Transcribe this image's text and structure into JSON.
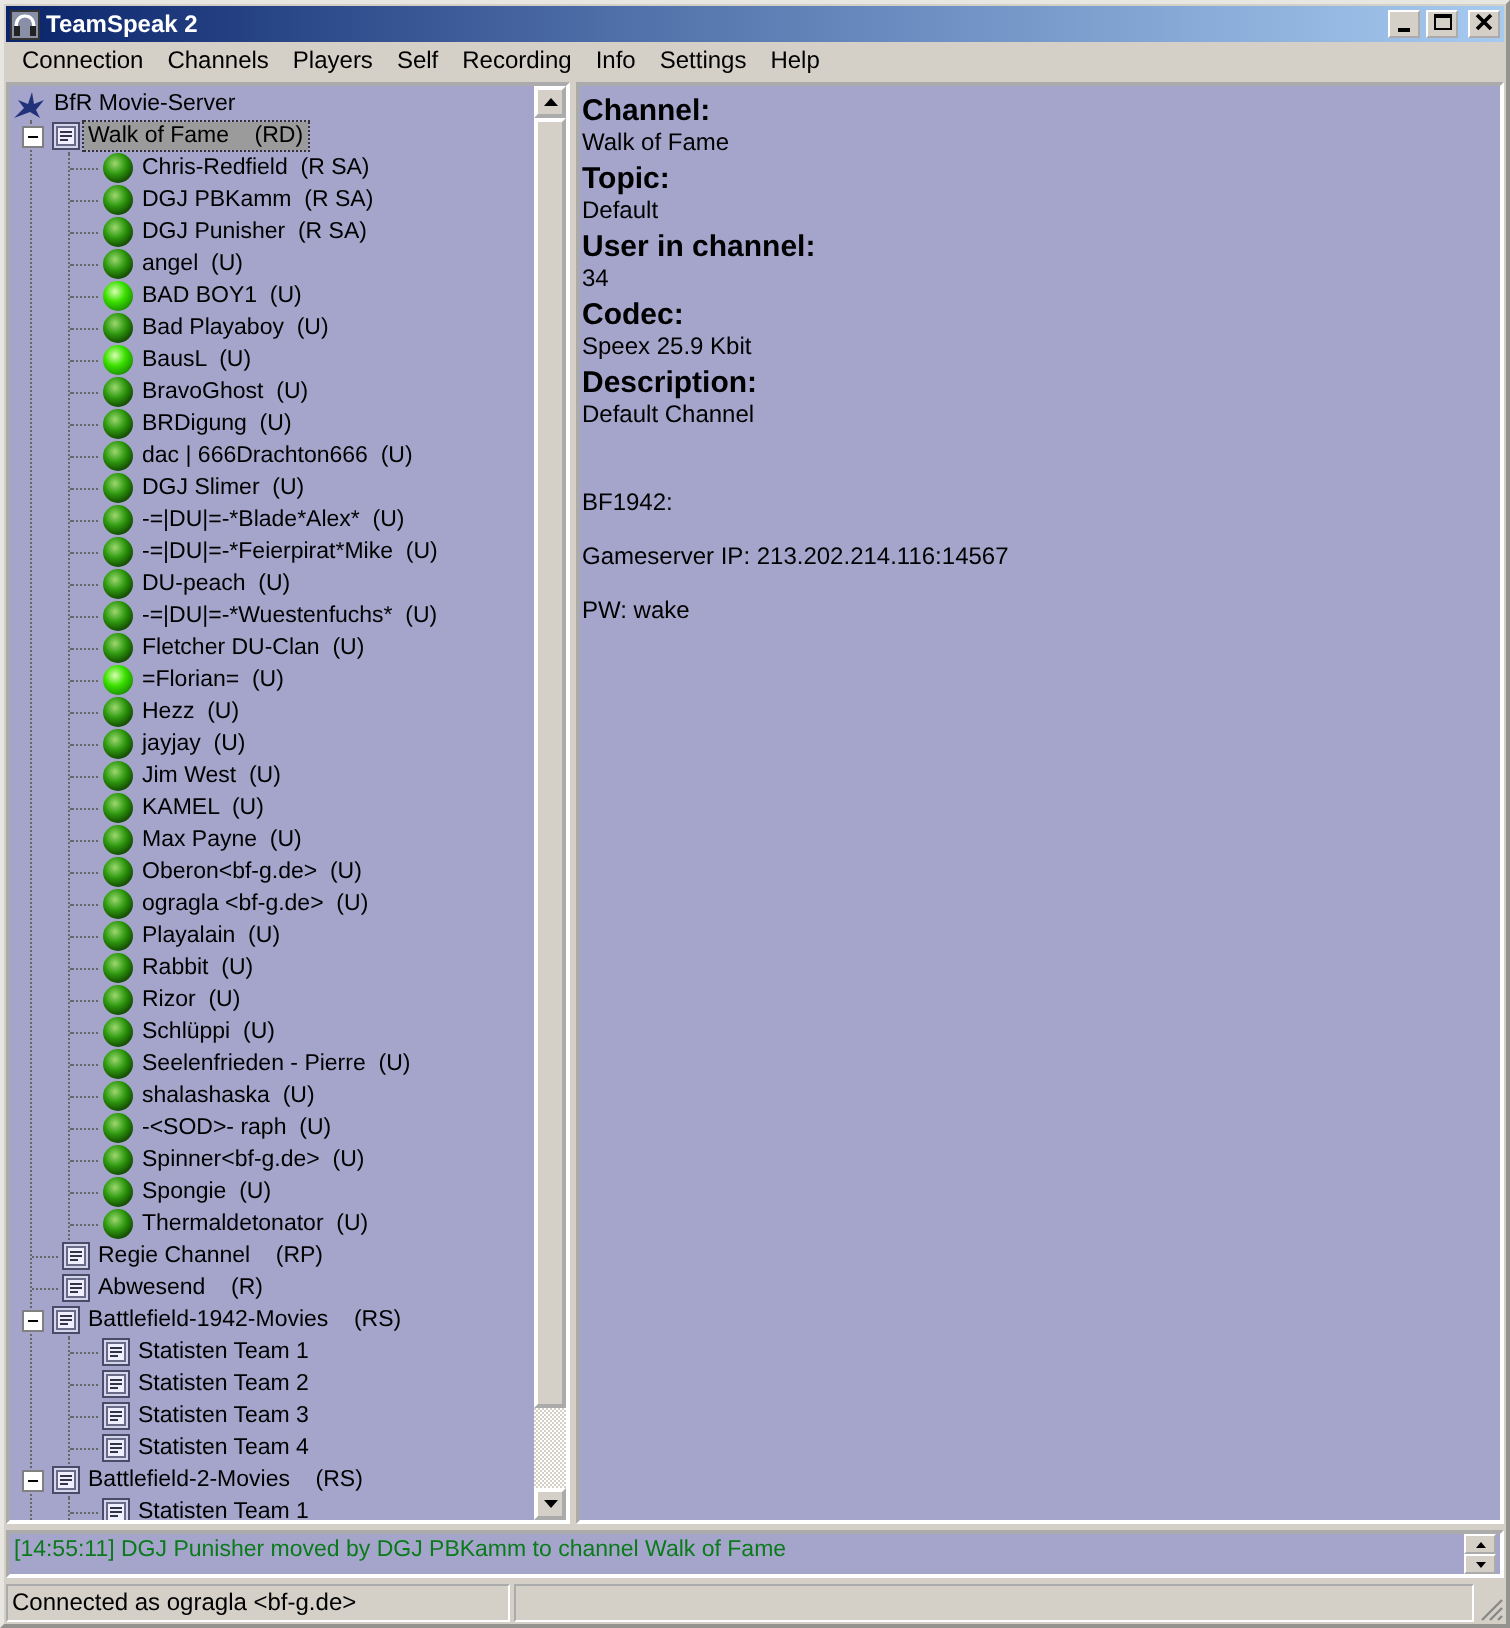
{
  "window": {
    "title": "TeamSpeak 2"
  },
  "menu": [
    "Connection",
    "Channels",
    "Players",
    "Self",
    "Recording",
    "Info",
    "Settings",
    "Help"
  ],
  "tree": {
    "server": "BfR Movie-Server",
    "channels": [
      {
        "name": "Walk of Fame",
        "flags": "(RD)",
        "expanded": true,
        "selected": true,
        "children": [
          {
            "kind": "player",
            "name": "Chris-Redfield",
            "flags": "(R SA)",
            "talking": false
          },
          {
            "kind": "player",
            "name": "DGJ PBKamm",
            "flags": "(R SA)",
            "talking": false
          },
          {
            "kind": "player",
            "name": "DGJ Punisher",
            "flags": "(R SA)",
            "talking": false
          },
          {
            "kind": "player",
            "name": "angel",
            "flags": "(U)",
            "talking": false
          },
          {
            "kind": "player",
            "name": "BAD BOY1",
            "flags": "(U)",
            "talking": true
          },
          {
            "kind": "player",
            "name": "Bad Playaboy",
            "flags": "(U)",
            "talking": false
          },
          {
            "kind": "player",
            "name": "BausL",
            "flags": "(U)",
            "talking": true
          },
          {
            "kind": "player",
            "name": "BravoGhost",
            "flags": "(U)",
            "talking": false
          },
          {
            "kind": "player",
            "name": "BRDigung",
            "flags": "(U)",
            "talking": false
          },
          {
            "kind": "player",
            "name": "dac | 666Drachton666",
            "flags": "(U)",
            "talking": false
          },
          {
            "kind": "player",
            "name": "DGJ Slimer",
            "flags": "(U)",
            "talking": false
          },
          {
            "kind": "player",
            "name": "-=|DU|=-*Blade*Alex*",
            "flags": "(U)",
            "talking": false
          },
          {
            "kind": "player",
            "name": "-=|DU|=-*Feierpirat*Mike",
            "flags": "(U)",
            "talking": false
          },
          {
            "kind": "player",
            "name": "DU-peach",
            "flags": "(U)",
            "talking": false
          },
          {
            "kind": "player",
            "name": "-=|DU|=-*Wuestenfuchs*",
            "flags": "(U)",
            "talking": false
          },
          {
            "kind": "player",
            "name": "Fletcher DU-Clan",
            "flags": "(U)",
            "talking": false
          },
          {
            "kind": "player",
            "name": "=Florian=",
            "flags": "(U)",
            "talking": true
          },
          {
            "kind": "player",
            "name": "Hezz",
            "flags": "(U)",
            "talking": false
          },
          {
            "kind": "player",
            "name": "jayjay",
            "flags": "(U)",
            "talking": false
          },
          {
            "kind": "player",
            "name": "Jim West",
            "flags": "(U)",
            "talking": false
          },
          {
            "kind": "player",
            "name": "KAMEL",
            "flags": "(U)",
            "talking": false
          },
          {
            "kind": "player",
            "name": "Max Payne",
            "flags": "(U)",
            "talking": false
          },
          {
            "kind": "player",
            "name": "Oberon<bf-g.de>",
            "flags": "(U)",
            "talking": false
          },
          {
            "kind": "player",
            "name": "ogragla <bf-g.de>",
            "flags": "(U)",
            "talking": false
          },
          {
            "kind": "player",
            "name": "Playalain",
            "flags": "(U)",
            "talking": false
          },
          {
            "kind": "player",
            "name": "Rabbit",
            "flags": "(U)",
            "talking": false
          },
          {
            "kind": "player",
            "name": "Rizor",
            "flags": "(U)",
            "talking": false
          },
          {
            "kind": "player",
            "name": "Schlüppi",
            "flags": "(U)",
            "talking": false
          },
          {
            "kind": "player",
            "name": "Seelenfrieden - Pierre",
            "flags": "(U)",
            "talking": false
          },
          {
            "kind": "player",
            "name": "shalashaska",
            "flags": "(U)",
            "talking": false
          },
          {
            "kind": "player",
            "name": "-<SOD>- raph",
            "flags": "(U)",
            "talking": false
          },
          {
            "kind": "player",
            "name": "Spinner<bf-g.de>",
            "flags": "(U)",
            "talking": false
          },
          {
            "kind": "player",
            "name": "Spongie",
            "flags": "(U)",
            "talking": false
          },
          {
            "kind": "player",
            "name": "Thermaldetonator",
            "flags": "(U)",
            "talking": false
          }
        ]
      },
      {
        "name": "Regie Channel",
        "flags": "(RP)",
        "selected": false
      },
      {
        "name": "Abwesend",
        "flags": "(R)",
        "selected": false
      },
      {
        "name": "Battlefield-1942-Movies",
        "flags": "(RS)",
        "expanded": true,
        "selected": false,
        "children": [
          {
            "kind": "channel",
            "name": "Statisten Team 1"
          },
          {
            "kind": "channel",
            "name": "Statisten Team 2"
          },
          {
            "kind": "channel",
            "name": "Statisten Team 3"
          },
          {
            "kind": "channel",
            "name": "Statisten Team 4"
          }
        ]
      },
      {
        "name": "Battlefield-2-Movies",
        "flags": "(RS)",
        "expanded": true,
        "selected": false,
        "children": [
          {
            "kind": "channel",
            "name": "Statisten Team 1"
          }
        ]
      }
    ]
  },
  "info": {
    "fields": [
      {
        "label": "Channel:",
        "value": "Walk of Fame"
      },
      {
        "label": "Topic:",
        "value": "Default"
      },
      {
        "label": "User in channel:",
        "value": "34"
      },
      {
        "label": "Codec:",
        "value": "Speex 25.9 Kbit"
      },
      {
        "label": "Description:",
        "value": "Default Channel"
      }
    ],
    "description_lines": [
      "BF1942:",
      "Gameserver IP: 213.202.214.116:14567",
      "PW: wake"
    ]
  },
  "log": [
    "[14:55:11] DGJ Punisher moved by DGJ PBKamm to channel Walk of Fame"
  ],
  "status_bar": "Connected as ogragla <bf-g.de>"
}
